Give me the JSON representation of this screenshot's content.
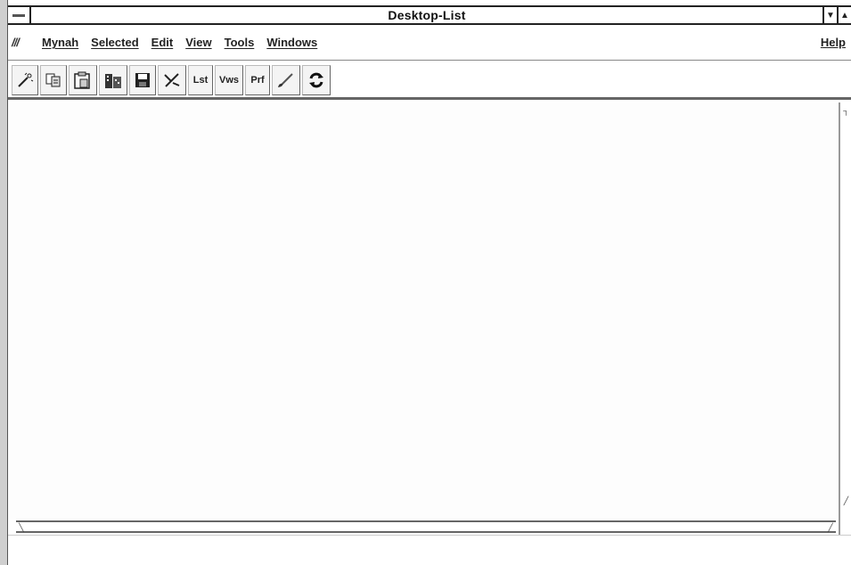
{
  "window": {
    "title": "Desktop-List"
  },
  "menubar": {
    "logo": "///",
    "items": [
      "Mynah",
      "Selected",
      "Edit",
      "View",
      "Tools",
      "Windows"
    ],
    "help": "Help"
  },
  "toolbar": {
    "buttons": [
      {
        "icon": "magic-wand-icon"
      },
      {
        "icon": "copy-icon"
      },
      {
        "icon": "paste-icon"
      },
      {
        "icon": "building-icon"
      },
      {
        "icon": "save-icon"
      },
      {
        "icon": "tool-icon"
      },
      {
        "label": "Lst"
      },
      {
        "label": "Vws"
      },
      {
        "label": "Prf"
      },
      {
        "icon": "brush-icon"
      },
      {
        "icon": "refresh-icon"
      }
    ]
  }
}
